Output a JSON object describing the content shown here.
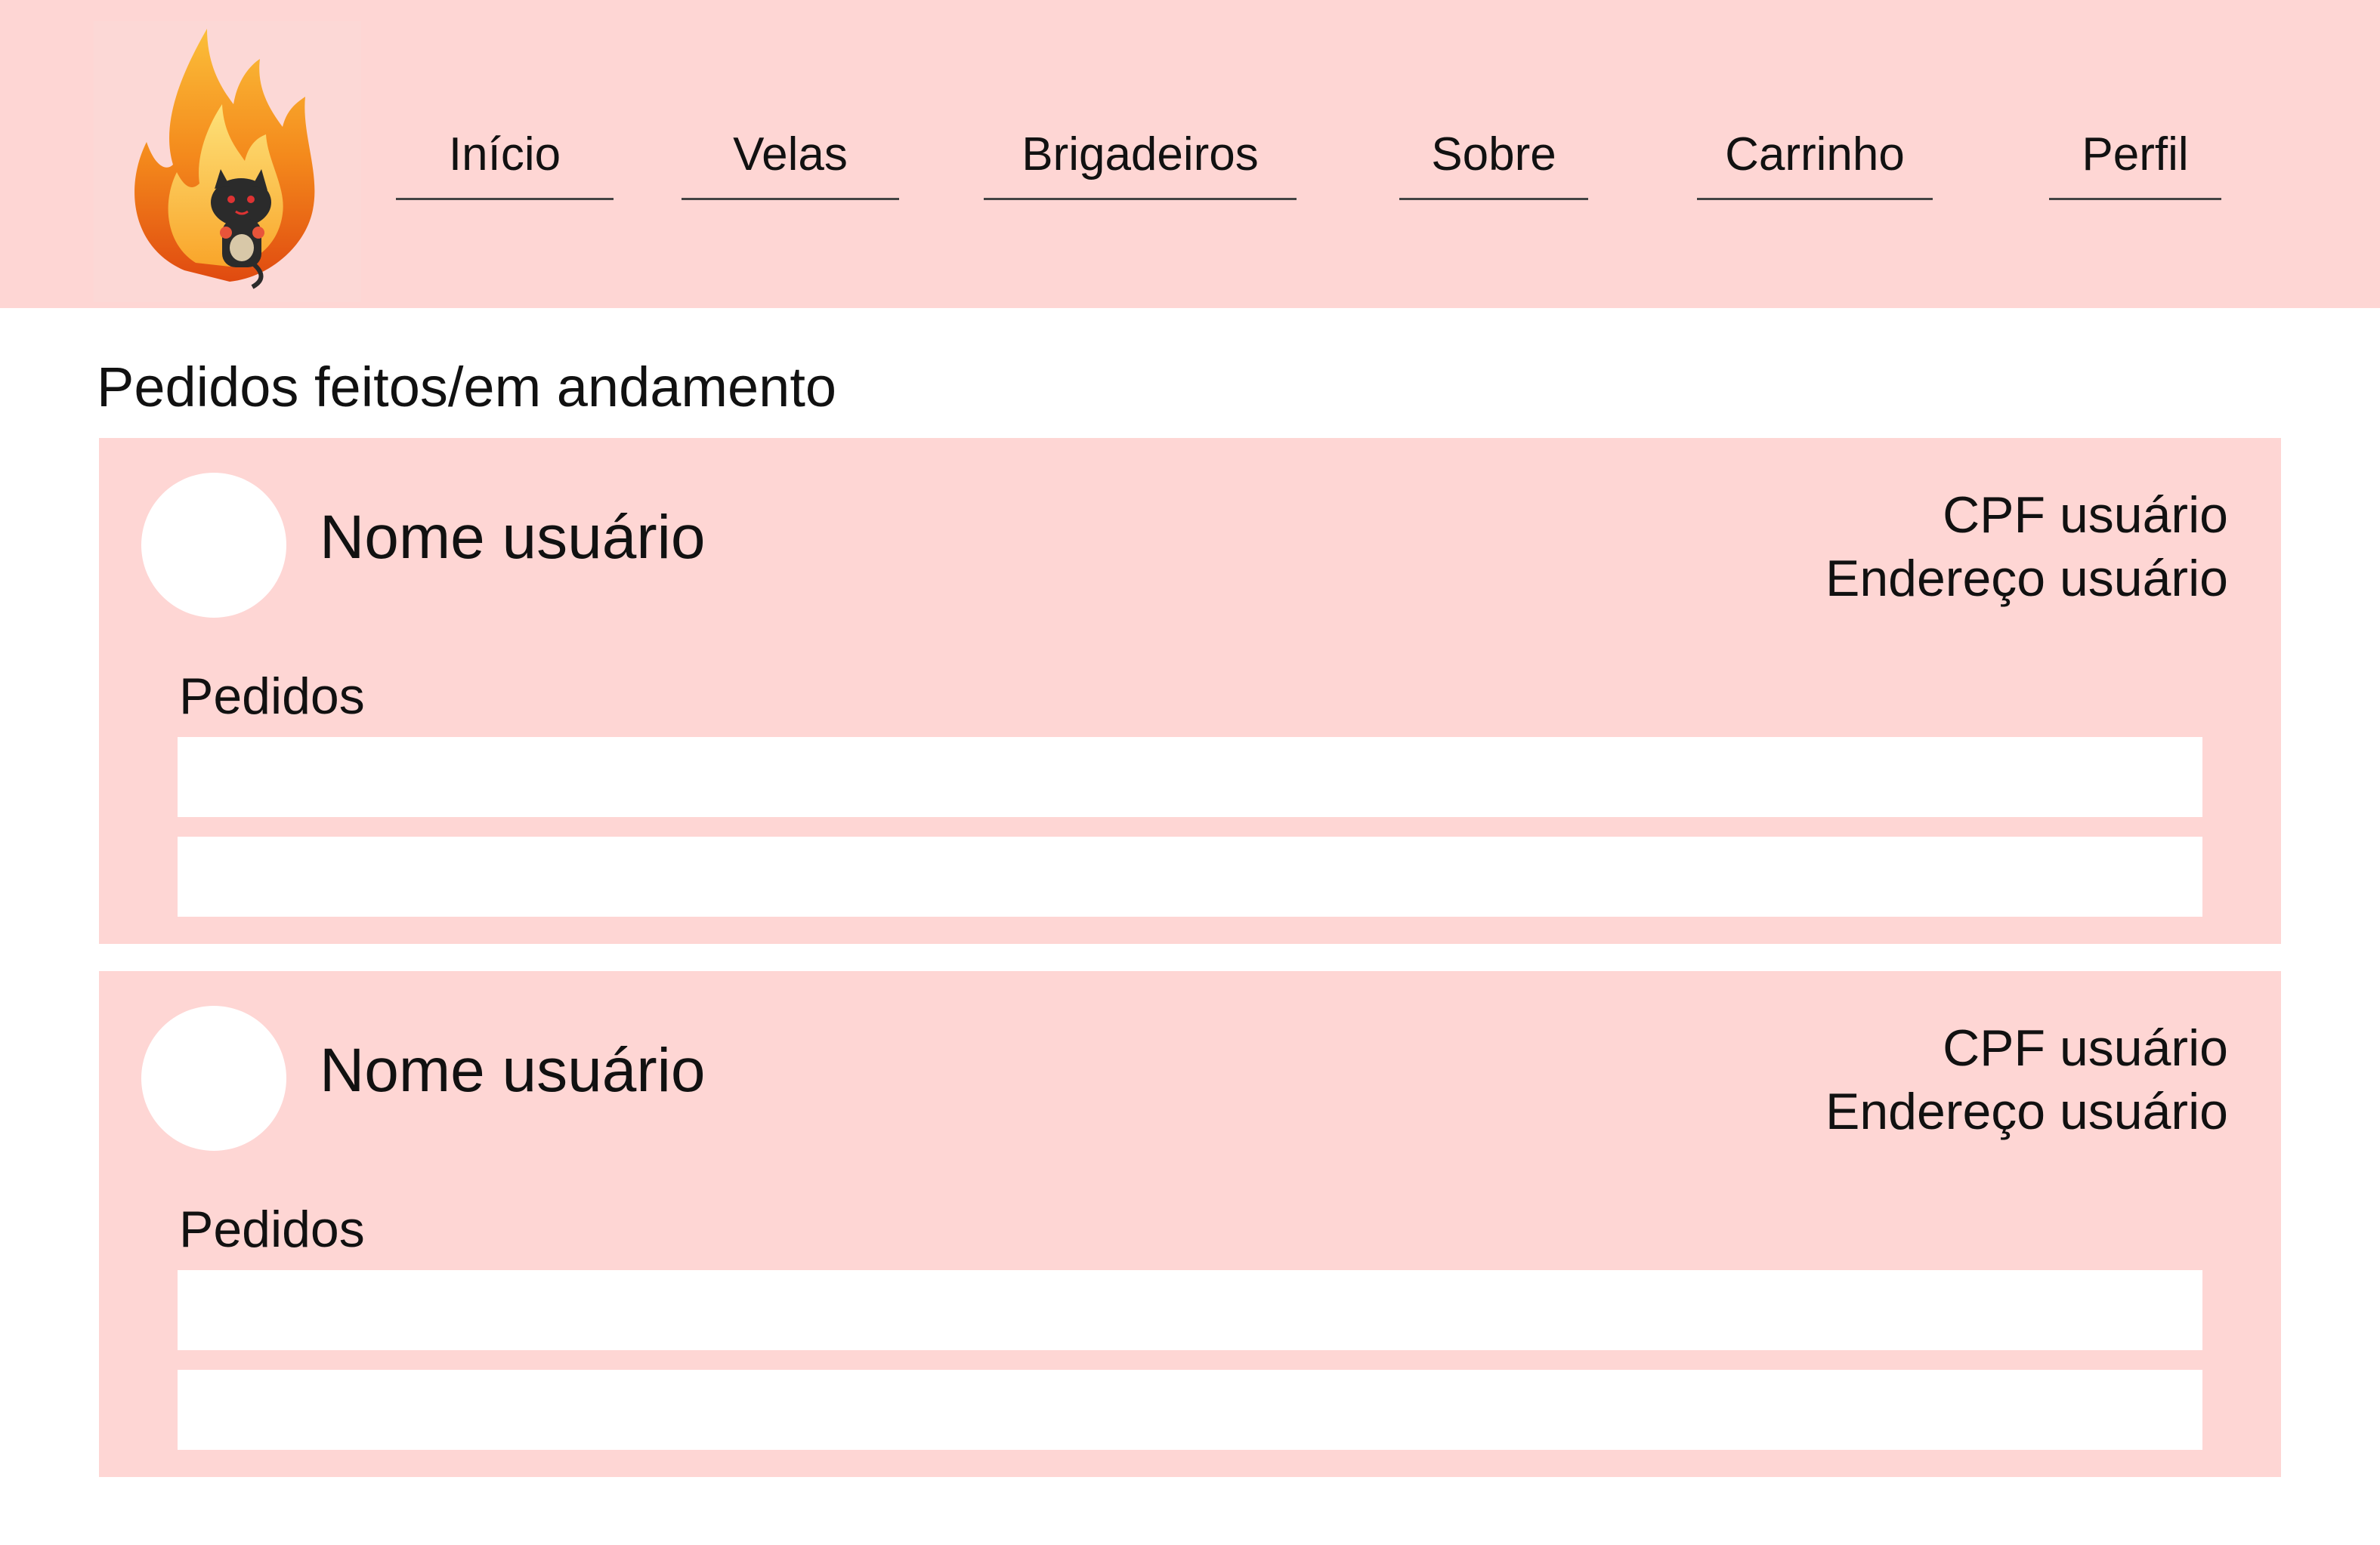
{
  "header": {
    "logo_icon": "flaming-cat-logo-icon",
    "nav": [
      {
        "label": "Início"
      },
      {
        "label": "Velas"
      },
      {
        "label": "Brigadeiros"
      },
      {
        "label": "Sobre"
      },
      {
        "label": "Carrinho"
      },
      {
        "label": "Perfil"
      }
    ]
  },
  "main": {
    "title": "Pedidos feitos/em andamento",
    "cards": [
      {
        "user_name": "Nome usuário",
        "cpf": "CPF usuário",
        "address": "Endereço usuário",
        "orders_label": "Pedidos"
      },
      {
        "user_name": "Nome usuário",
        "cpf": "CPF usuário",
        "address": "Endereço usuário",
        "orders_label": "Pedidos"
      }
    ]
  },
  "colors": {
    "header_bg": "#fed6d4",
    "card_bg": "#fed6d4",
    "page_bg": "#ffffff"
  }
}
